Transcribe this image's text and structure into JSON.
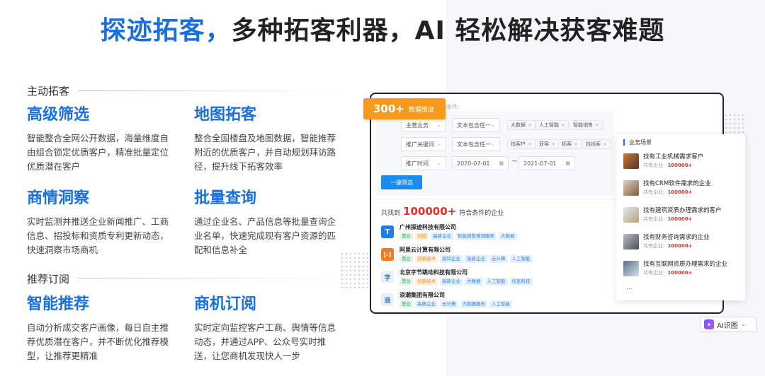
{
  "headline": {
    "accent": "探迹拓客，",
    "rest": "多种拓客利器，AI 轻松解决获客难题"
  },
  "sections": {
    "active": "主动拓客",
    "recommend": "推荐订阅"
  },
  "features": [
    {
      "title": "高级筛选",
      "desc": "智能整合全网公开数据，海量维度自由组合锁定优质客户，精准批量定位优质潜在客户"
    },
    {
      "title": "地图拓客",
      "desc": "整合全国楼盘及地图数据，智能推荐附近的优质客户，并自动规划拜访路径，提升线下拓客效率"
    },
    {
      "title": "商情洞察",
      "desc": "实时监测并推送企业新闻推广、工商信息、招投标和资质专利更新动态，快速洞察市场商机"
    },
    {
      "title": "批量查询",
      "desc": "通过企业名、产品信息等批量查询企业名单，快速完成现有客户资源的匹配和信息补全"
    },
    {
      "title": "智能推荐",
      "desc": "自动分析成交客户画像，每日自主推荐优质潜在客户，并不断优化推荐模型，让推荐更精准"
    },
    {
      "title": "商机订阅",
      "desc": "实时定向监控客户工商、舆情等信息动态，并通过APP、公众号实时推送，让您商机发现快人一步"
    }
  ],
  "card": {
    "badge_num": "300+",
    "badge_label": "数据维度",
    "cond_hint": "条件:",
    "rows": [
      {
        "field": "主营业务",
        "op": "文本包含任一",
        "tags": [
          "大数据",
          "人工智能",
          "智能销售"
        ]
      },
      {
        "field": "推广关键词",
        "op": "文本包含任一",
        "tags": [
          "找客户",
          "获客",
          "拓客",
          "找线索"
        ]
      }
    ],
    "date_row": {
      "field": "推广时间",
      "from": "2020-07-01",
      "to": "2021-07-01",
      "sep": "~"
    },
    "filter_button": "一键筛选",
    "found_prefix": "共找到",
    "found_count": "100000+",
    "found_suffix": "符合条件的企业",
    "companies": [
      {
        "name": "广州探迹科技有限公司",
        "logo": "T",
        "tags": [
          "营业",
          "创投",
          "高新企业",
          "智能销售预测服务",
          "大数据"
        ]
      },
      {
        "name": "阿里云计算有限公司",
        "logo": "[-]",
        "tags": [
          "营业",
          "创新技术",
          "高科企业",
          "高新企业",
          "云计算",
          "人工智能"
        ]
      },
      {
        "name": "北京字节跳动科技有限公司",
        "logo": "字",
        "tags": [
          "营业",
          "创新技术",
          "高新企业",
          "大数据",
          "人工智能",
          "信息科技"
        ]
      },
      {
        "name": "浪潮集团有限公司",
        "logo": "浪",
        "tags": [
          "营业",
          "高新企业",
          "云计算",
          "大数据服务",
          "人工智能"
        ]
      }
    ]
  },
  "scene": {
    "title": "业务场景",
    "items": [
      {
        "title": "找有工业机械需求客户",
        "sub": "共有企业:",
        "count": "100000+"
      },
      {
        "title": "找有CRM软件需求的企业",
        "sub": "共有企业:",
        "count": "100000+"
      },
      {
        "title": "找有建筑资质办理需求的客户",
        "sub": "共有企业:",
        "count": "100000+"
      },
      {
        "title": "找有财务咨询需求的企业",
        "sub": "共有企业:",
        "count": "100000+"
      },
      {
        "title": "找有互联网资质办理需求的企业",
        "sub": "共有企业:",
        "count": "100000+"
      }
    ],
    "more": "..."
  },
  "ai_button": {
    "label": "AI识图",
    "caret": "⌄"
  },
  "colors": {
    "accent": "#1a6fe0",
    "orange": "#f79a1c",
    "red": "#e8302a"
  }
}
